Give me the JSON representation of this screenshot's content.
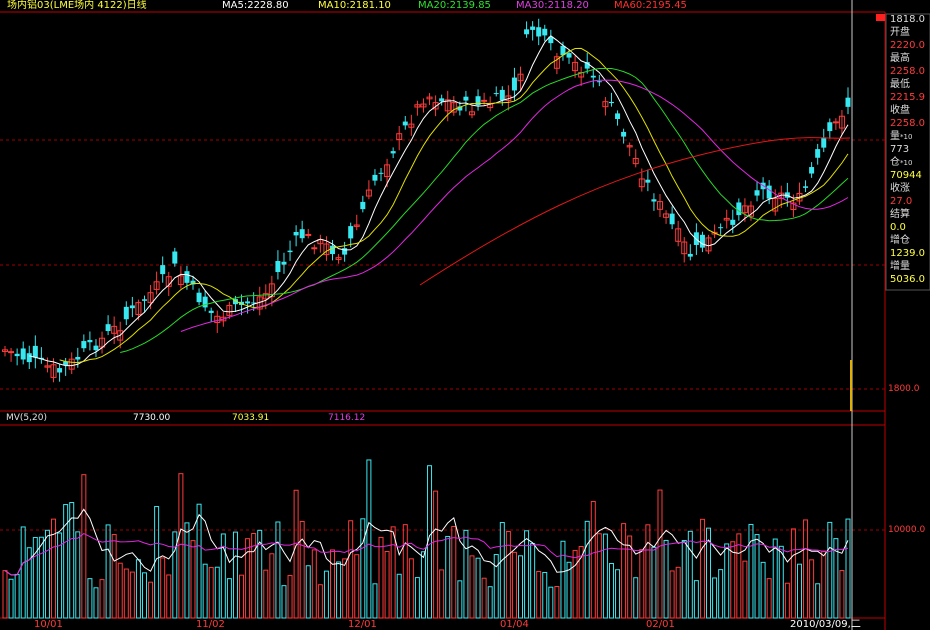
{
  "header": {
    "title": "场内铝03(LME场内 4122)日线",
    "ma5": "MA5:2228.80",
    "ma10": "MA10:2181.10",
    "ma20": "MA20:2139.85",
    "ma30": "MA30:2118.20",
    "ma60": "MA60:2195.45"
  },
  "side_panel": {
    "top_value": "1818.0",
    "open_label": "开盘",
    "open_value": "2220.0",
    "high_label": "最高",
    "high_value": "2258.0",
    "low_label": "最低",
    "low_value": "2215.9",
    "close_label": "收盘",
    "close_value": "2258.0",
    "volume_label": "量",
    "volume_unit": "*10",
    "volume_value": "773",
    "position_label": "仓",
    "position_unit": "*10",
    "position_value": "70944",
    "change_label": "收涨",
    "change_value": "27.0",
    "settle_label": "结算",
    "settle_value": "0.0",
    "pos_inc_label": "增仓",
    "pos_inc_value": "1239.0",
    "vol_inc_label": "增量",
    "vol_inc_value": "5036.0"
  },
  "price_axis": {
    "level": "1800.0"
  },
  "volume_panel": {
    "label": "MV(5,20)",
    "v1": "7730.00",
    "v2": "7033.91",
    "v3": "7116.12",
    "level": "10000.0"
  },
  "dates": [
    "10/01",
    "11/02",
    "12/01",
    "01/04",
    "02/01",
    "2010/03/09,二"
  ],
  "colors": {
    "up": "#ff3b3b",
    "down": "#38e8f0",
    "ma5": "#ffffff",
    "ma10": "#e0e000",
    "ma20": "#28d828",
    "ma30": "#e028e0",
    "ma60": "#e01818"
  }
}
